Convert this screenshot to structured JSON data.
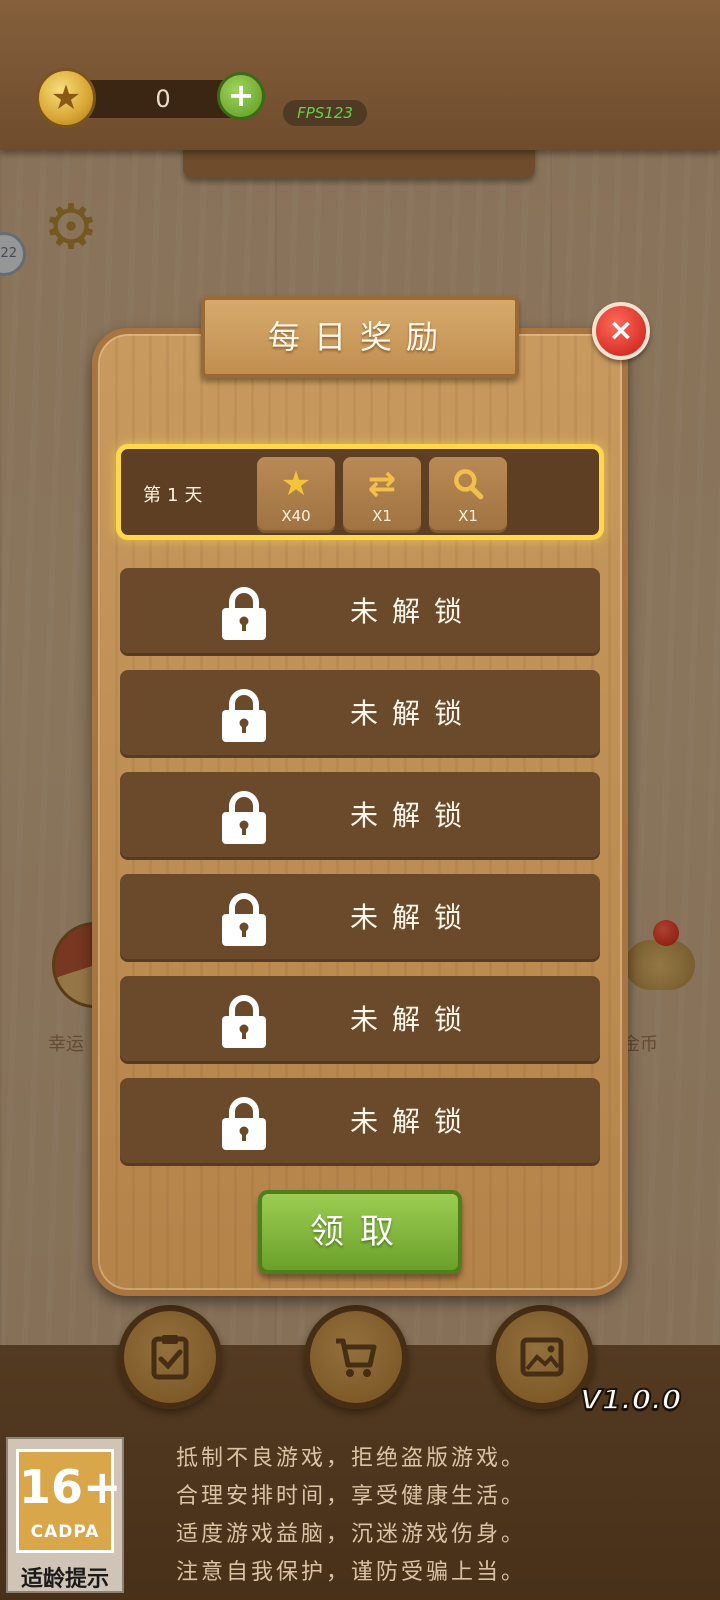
{
  "header": {
    "coin_count": "0",
    "add_label": "+",
    "fps_label": "FPS123",
    "level_badge": "22"
  },
  "side": {
    "left_label": "幸运",
    "right_label": "金币"
  },
  "dialog": {
    "title": "每日奖励",
    "close_label": "×",
    "day1": {
      "label": "第1天",
      "rewards": [
        {
          "icon": "star-coin-icon",
          "qty": "X40"
        },
        {
          "icon": "shuffle-icon",
          "qty": "X1"
        },
        {
          "icon": "magnifier-icon",
          "qty": "X1"
        }
      ]
    },
    "locked_rows": [
      {
        "label": "未解锁"
      },
      {
        "label": "未解锁"
      },
      {
        "label": "未解锁"
      },
      {
        "label": "未解锁"
      },
      {
        "label": "未解锁"
      },
      {
        "label": "未解锁"
      }
    ],
    "claim_label": "领取"
  },
  "bottom_nav": {
    "version": "V1.0.0",
    "buttons": [
      "task-icon",
      "cart-icon",
      "gallery-icon"
    ]
  },
  "age_rating": {
    "number": "16+",
    "org": "CADPA",
    "tip": "适龄提示"
  },
  "health_notice": [
    "抵制不良游戏，拒绝盗版游戏。",
    "合理安排时间，享受健康生活。",
    "适度游戏益脑，沉迷游戏伤身。",
    "注意自我保护，谨防受骗上当。"
  ],
  "colors": {
    "highlight": "#ffd84a",
    "claim_green": "#7fb83a",
    "close_red": "#d8261c",
    "row_brown": "#6b4a2c"
  }
}
